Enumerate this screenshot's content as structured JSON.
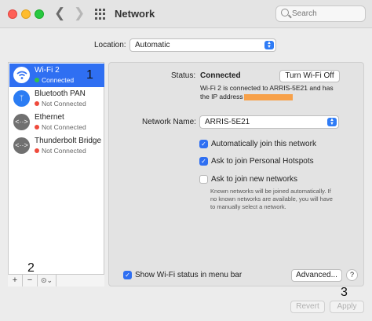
{
  "window": {
    "title": "Network"
  },
  "search": {
    "placeholder": "Search",
    "icon": "search-icon"
  },
  "location": {
    "label": "Location:",
    "value": "Automatic"
  },
  "services": [
    {
      "name": "Wi-Fi 2",
      "status": "Connected",
      "status_color": "#33c24b",
      "icon": "wifi-icon",
      "selected": true
    },
    {
      "name": "Bluetooth PAN",
      "status": "Not Connected",
      "status_color": "#ef4a3c",
      "icon": "bluetooth-icon"
    },
    {
      "name": "Ethernet",
      "status": "Not Connected",
      "status_color": "#ef4a3c",
      "icon": "ethernet-icon"
    },
    {
      "name": "Thunderbolt Bridge",
      "status": "Not Connected",
      "status_color": "#ef4a3c",
      "icon": "thunderbolt-bridge-icon"
    }
  ],
  "sidebar_controls": {
    "add": "+",
    "remove": "−",
    "action": "⊙⌄"
  },
  "annotations": {
    "one": "1",
    "two": "2",
    "three": "3"
  },
  "detail": {
    "status_label": "Status:",
    "status_value": "Connected",
    "turn_off_button": "Turn Wi-Fi Off",
    "status_desc_line1": "Wi-Fi 2 is connected to ARRIS-5E21 and has",
    "status_desc_line2": "the IP address",
    "network_name_label": "Network Name:",
    "network_name_value": "ARRIS-5E21",
    "auto_join": "Automatically join this network",
    "ask_hotspots": "Ask to join Personal Hotspots",
    "ask_new": "Ask to join new networks",
    "known_note_1": "Known networks will be joined automatically. If",
    "known_note_2": "no known networks are available, you will have",
    "known_note_3": "to manually select a network.",
    "show_status": "Show Wi-Fi status in menu bar",
    "advanced_button": "Advanced...",
    "help_button": "?"
  },
  "footer": {
    "revert": "Revert",
    "apply": "Apply"
  },
  "colors": {
    "accent": "#2f6ff2",
    "connected": "#33c24b",
    "not_connected": "#ef4a3c",
    "redaction": "#f7a14a"
  }
}
